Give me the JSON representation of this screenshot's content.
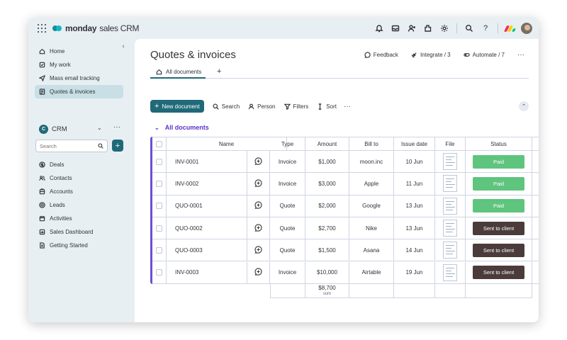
{
  "topbar": {
    "brand_bold": "monday",
    "brand_light": "sales CRM",
    "icons": [
      "bell-icon",
      "inbox-icon",
      "invite-icon",
      "apps-icon",
      "settings-icon",
      "search-icon",
      "help-icon"
    ]
  },
  "sidebar": {
    "collapse_glyph": "‹",
    "top_items": [
      {
        "label": "Home",
        "icon": "home-icon"
      },
      {
        "label": "My work",
        "icon": "checkbox-icon"
      },
      {
        "label": "Mass email tracking",
        "icon": "send-icon"
      },
      {
        "label": "Quotes & invoices",
        "icon": "document-icon",
        "active": true
      }
    ],
    "workspace": {
      "badge": "C",
      "name": "CRM"
    },
    "search_placeholder": "Search",
    "board_items": [
      {
        "label": "Deals",
        "icon": "dollar-icon"
      },
      {
        "label": "Contacts",
        "icon": "contacts-icon"
      },
      {
        "label": "Accounts",
        "icon": "accounts-icon"
      },
      {
        "label": "Leads",
        "icon": "target-icon"
      },
      {
        "label": "Activities",
        "icon": "calendar-icon"
      },
      {
        "label": "Sales Dashboard",
        "icon": "dashboard-icon"
      },
      {
        "label": "Getting Started",
        "icon": "doc-icon"
      }
    ]
  },
  "main": {
    "title": "Quotes & invoices",
    "actions": {
      "feedback": "Feedback",
      "integrate": "Integrate / 3",
      "automate": "Automate / 7"
    },
    "tab_label": "All documents",
    "toolbar": {
      "new": "New document",
      "search": "Search",
      "person": "Person",
      "filters": "Filters",
      "sort": "Sort"
    },
    "group_name": "All documents",
    "columns": [
      "Name",
      "Type",
      "Amount",
      "Bill to",
      "Issue date",
      "File",
      "Status"
    ],
    "rows": [
      {
        "name": "INV-0001",
        "type": "Invoice",
        "amount": "$1,000",
        "bill_to": "moon.inc",
        "date": "10 Jun",
        "status": "Paid"
      },
      {
        "name": "INV-0002",
        "type": "Invoice",
        "amount": "$3,000",
        "bill_to": "Apple",
        "date": "11 Jun",
        "status": "Paid"
      },
      {
        "name": "QUO-0001",
        "type": "Quote",
        "amount": "$2,000",
        "bill_to": "Google",
        "date": "13 Jun",
        "status": "Paid"
      },
      {
        "name": "QUO-0002",
        "type": "Quote",
        "amount": "$2,700",
        "bill_to": "Nike",
        "date": "13 Jun",
        "status": "Sent to client"
      },
      {
        "name": "QUO-0003",
        "type": "Quote",
        "amount": "$1,500",
        "bill_to": "Asana",
        "date": "14 Jun",
        "status": "Sent to client"
      },
      {
        "name": "INV-0003",
        "type": "Invoice",
        "amount": "$10,000",
        "bill_to": "Airtable",
        "date": "19 Jun",
        "status": "Sent to client"
      }
    ],
    "sum_value": "$8,700",
    "sum_label": "sum",
    "status_colors": {
      "Paid": "#5ec47e",
      "Sent to client": "#4b3b3b"
    }
  }
}
